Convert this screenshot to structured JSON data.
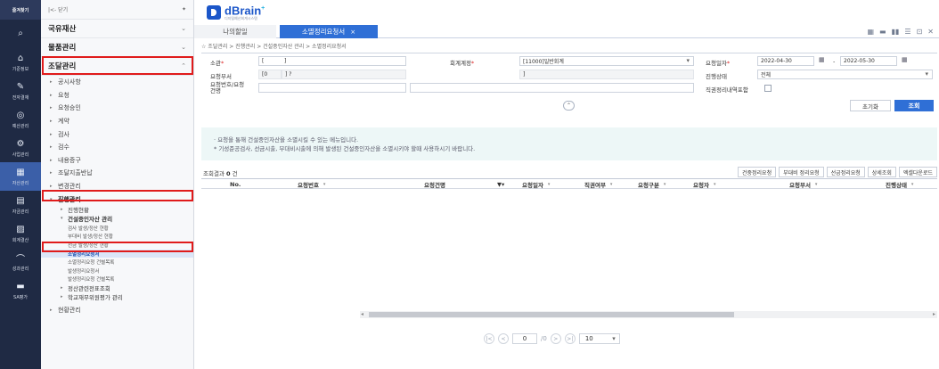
{
  "rail": {
    "top_label": "즐겨찾기",
    "items": [
      {
        "label": "",
        "icon": "search-icon"
      },
      {
        "label": "기준정보",
        "icon": "home-icon"
      },
      {
        "label": "전자결재",
        "icon": "pen-icon"
      },
      {
        "label": "예산관리",
        "icon": "coins-icon"
      },
      {
        "label": "사업관리",
        "icon": "gear-icon"
      },
      {
        "label": "자산관리",
        "icon": "building-icon"
      },
      {
        "label": "자금관리",
        "icon": "money-icon"
      },
      {
        "label": "회계결산",
        "icon": "report-icon"
      },
      {
        "label": "성과관리",
        "icon": "chart-icon"
      },
      {
        "label": "SA평가",
        "icon": "folder-icon"
      }
    ]
  },
  "menu": {
    "back_label": "|<- 닫기",
    "pin_icon": "pin-icon",
    "level1": [
      {
        "label": "국유재산",
        "chev": "⌄"
      },
      {
        "label": "물품관리",
        "chev": "⌄"
      },
      {
        "label": "조달관리",
        "chev": "⌃"
      }
    ],
    "level2": [
      "공시사항",
      "요청",
      "요청승인",
      "계약",
      "검사",
      "검수",
      "내용증구",
      "조달지출반납",
      "변경관리"
    ],
    "active_group": "진행관리",
    "sub_a": "진행현황",
    "sub_b": "건설중인자산 관리",
    "leaves": [
      "검사 발생/정산 현황",
      "부대비 발생/정산 현황",
      "선금 발생/정산 현황",
      "소멸정리요청서",
      "소멸정리요청 건별목록",
      "발생정리요청서",
      "발생정리요청 건별목록"
    ],
    "tail_items": [
      "정산관련전표조회",
      "학교재무위원평가 관리"
    ],
    "last_item": "현황관리"
  },
  "header": {
    "brand": "dBrain",
    "brand_plus": "+",
    "brand_sub": "디지털예산회계시스템",
    "tab_inactive": "나의할일",
    "tab_active": "소멸정리요청서",
    "tab_close": "×",
    "win_icons": [
      "▦",
      "▬",
      "▮▮",
      "☰",
      "⊡",
      "✕"
    ]
  },
  "breadcrumb": "조달관리 > 진행관리 > 건설중인자산 관리 > 소멸정리요청서",
  "form": {
    "label_dept": "소관",
    "val_dept_code": "[",
    "val_dept_suffix": "]",
    "label_unit": "요청부서",
    "val_unit_code": "[0",
    "val_unit_suffix": "] ?",
    "label_req_no": "요청번호/요청",
    "label_req_no2": "건명",
    "label_acct": "회계계정",
    "val_acct": "[11000]일반회계",
    "val_acct_sub": "]",
    "label_date": "요청일자",
    "date_from": "2022-04-30",
    "date_to": "2022-05-30",
    "date_sep": "-",
    "label_status": "진행상태",
    "val_status": "전체",
    "label_direct": "직권정리내역포함",
    "reset_btn": "초기화",
    "search_btn": "조회",
    "collapse": "⌃"
  },
  "notice": {
    "line1": "· 요청을 통해 건설중인자산을 소멸시킬 수 있는 메뉴입니다.",
    "line2": "* 기성준공검사, 선금시출, 부대비시출에 의해 발생된 건설중인자산을 소멸시키야 할때 사용하시기 바랍니다."
  },
  "results": {
    "label": "조회결과",
    "count": "0",
    "unit": "건",
    "actions": [
      "건중정리요청",
      "부대비 정리요청",
      "선금정리요청",
      "상세조회",
      "엑셀다운로드"
    ]
  },
  "grid": {
    "columns": [
      "No.",
      "요청번호",
      "요청건명",
      "요청일자",
      "직권여부",
      "요청구분",
      "요청자",
      "요청부서",
      "진행상태"
    ]
  },
  "pager": {
    "first": "|<",
    "prev": "<",
    "page": "0",
    "of": "/0",
    "next": ">",
    "last": ">|",
    "size": "10"
  }
}
